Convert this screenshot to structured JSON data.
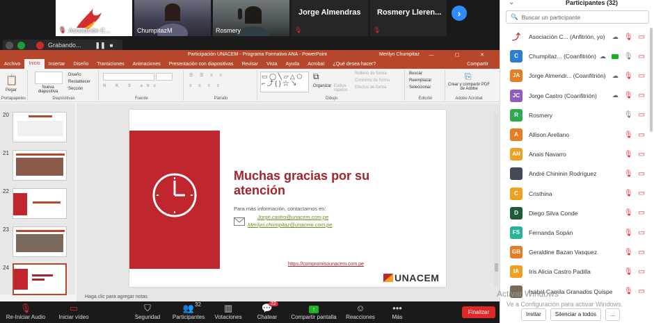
{
  "video": {
    "tiles": [
      {
        "name": "Asociación C..."
      },
      {
        "name": "ChumpitazM"
      },
      {
        "name": "Rosmery"
      },
      {
        "name": "Jorge Almendras"
      },
      {
        "name": "Rosmery Lleren..."
      }
    ]
  },
  "recording": {
    "label": "Grabando..."
  },
  "ppt": {
    "title": "Participación UNACEM - Programa Formativo ANA - PowerPoint",
    "user": "Merilyn Chumpitaz",
    "tabs": [
      "Archivo",
      "Inicio",
      "Insertar",
      "Diseño",
      "Transiciones",
      "Animaciones",
      "Presentación con diapositivas",
      "Revisar",
      "Vista",
      "Ayuda",
      "Acrobat",
      "¿Qué desea hacer?"
    ],
    "share_label": "Compartir",
    "ribbon": {
      "groups": [
        "Portapapeles",
        "Diapositivas",
        "Fuente",
        "Párrafo",
        "Dibujo",
        "Edición",
        "Adobe Acrobat"
      ],
      "pegar": "Pegar",
      "nueva": "Nueva diapositiva",
      "diseno": "Diseño",
      "restablecer": "Restablecer",
      "seccion": "Sección",
      "organizar": "Organizar",
      "estilos": "Estilos rápidos",
      "relleno": "Relleno de forma",
      "contorno": "Contorno de forma",
      "efectos": "Efectos de forma",
      "buscar": "Buscar",
      "reemplazar": "Reemplazar",
      "seleccionar": "Seleccionar",
      "pdf": "Crear y compartir PDF de Adobe"
    },
    "slides": [
      {
        "num": "20"
      },
      {
        "num": "21"
      },
      {
        "num": "22"
      },
      {
        "num": "23"
      },
      {
        "num": "24"
      }
    ],
    "current_slide": {
      "title": "Muchas gracias por su atención",
      "info": "Para más información, contactarnos en:",
      "email1": "Jorge.castro@unacem.com.pe",
      "email2": "Merilyn.chumpitaz@unacem.com.pe",
      "url": "https://compromisounacem.com.pe",
      "logo": "UNACEM"
    },
    "notes_placeholder": "Haga clic para agregar notas"
  },
  "participants": {
    "header": "Participantes (32)",
    "search_placeholder": "Buscar un participante",
    "list": [
      {
        "name": "Asociación C... (Anfitrión, yo)",
        "initials": "",
        "color": "#ffffff",
        "mic": "off",
        "cam": "off"
      },
      {
        "name": "Chumpitaz... (Coanfitrión)",
        "initials": "C",
        "color": "#2d7dd2",
        "mic": "on",
        "cam": "off",
        "screen": true
      },
      {
        "name": "Jorge Almendr... (Coanfitrión)",
        "initials": "JA",
        "color": "#e97b22",
        "mic": "off",
        "cam": "off"
      },
      {
        "name": "Jorge Castro (Coanfitrión)",
        "initials": "JC",
        "color": "#8e5bc0",
        "mic": "off",
        "cam": "off"
      },
      {
        "name": "Rosmery",
        "initials": "R",
        "color": "#2eaa4f",
        "mic": "on",
        "cam": "off"
      },
      {
        "name": "Allison Arellano",
        "initials": "A",
        "color": "#e97b22",
        "mic": "off",
        "cam": "off"
      },
      {
        "name": "Anais Navarro",
        "initials": "AN",
        "color": "#f0a020",
        "mic": "off",
        "cam": "off"
      },
      {
        "name": "André Chininin Rodríguez",
        "initials": "",
        "color": "#444a55",
        "mic": "off",
        "cam": "off"
      },
      {
        "name": "Cristhina",
        "initials": "C",
        "color": "#f0a020",
        "mic": "off",
        "cam": "off"
      },
      {
        "name": "Diego Silva Conde",
        "initials": "D",
        "color": "#1e5c3a",
        "mic": "off",
        "cam": "off"
      },
      {
        "name": "Fernanda Sopán",
        "initials": "FS",
        "color": "#27b39b",
        "mic": "off",
        "cam": "off"
      },
      {
        "name": "Geraldine Bazan Vasquez",
        "initials": "GB",
        "color": "#e97b22",
        "mic": "off",
        "cam": "off"
      },
      {
        "name": "Iris Alicia Castro Padilla",
        "initials": "IA",
        "color": "#f0a020",
        "mic": "off",
        "cam": "off"
      },
      {
        "name": "Isabel Camila Granados Quispe",
        "initials": "",
        "color": "#7a6a5a",
        "mic": "off",
        "cam": "off"
      }
    ],
    "invite": "Invitar",
    "mute_all": "Silenciar a todos",
    "more": "...",
    "watermark1": "Activar Windows",
    "watermark2": "Ve a Configuración para activar Windows."
  },
  "toolbar": {
    "audio": "Re-Iniciar Audio",
    "video": "Iniciar vídeo",
    "security": "Seguridad",
    "participants": "Participantes",
    "participants_count": "32",
    "polls": "Votaciones",
    "chat": "Chatear",
    "chat_badge": "32",
    "share": "Compartir pantalla",
    "reactions": "Reacciones",
    "more": "Más",
    "end": "Finalizar"
  },
  "colors": {
    "ppt_accent": "#b7472a",
    "slide_red": "#c0262d",
    "zoom_blue": "#2d8cff",
    "end_red": "#e02828"
  }
}
